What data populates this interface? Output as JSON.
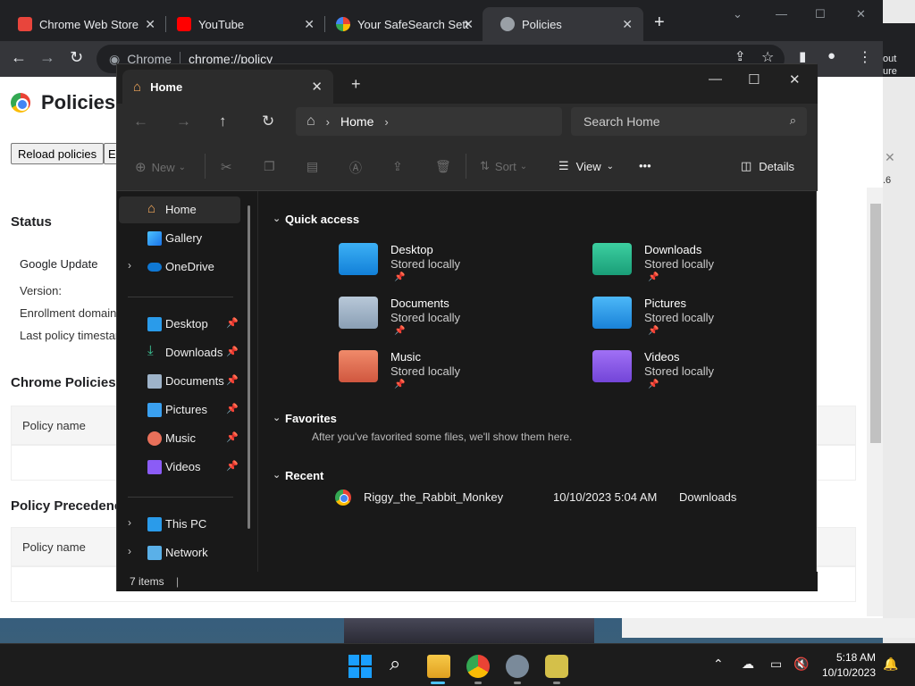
{
  "browser": {
    "tabs": [
      {
        "label": "Chrome Web Store"
      },
      {
        "label": "YouTube"
      },
      {
        "label": "Your SafeSearch Sett"
      },
      {
        "label": "Policies"
      }
    ],
    "new_tab": "+",
    "omnibox": {
      "site": "Chrome",
      "url": "chrome://policy"
    }
  },
  "policy_page": {
    "title": "Policies",
    "buttons": [
      "Reload policies",
      "E"
    ],
    "status_heading": "Status",
    "google_update": "Google Update",
    "version_label": "Version:",
    "enrollment_label": "Enrollment domain",
    "last_policy_label": "Last policy timestar",
    "chrome_policies_heading": "Chrome Policies",
    "policy_name_col": "Policy name",
    "precedence_heading": "Policy Precedenc",
    "precedence_col": "Policy name"
  },
  "behind_window": {
    "text_1": "out",
    "text_2": "ure",
    "text_3": ".6"
  },
  "explorer": {
    "tab_title": "Home",
    "breadcrumb": "Home",
    "search_placeholder": "Search Home",
    "commands": {
      "new": "New",
      "sort": "Sort",
      "view": "View",
      "more": "•••",
      "details": "Details"
    },
    "sidebar": {
      "top": [
        {
          "label": "Home"
        },
        {
          "label": "Gallery"
        },
        {
          "label": "OneDrive"
        }
      ],
      "pinned": [
        {
          "label": "Desktop"
        },
        {
          "label": "Downloads"
        },
        {
          "label": "Documents"
        },
        {
          "label": "Pictures"
        },
        {
          "label": "Music"
        },
        {
          "label": "Videos"
        }
      ],
      "bottom": [
        {
          "label": "This PC"
        },
        {
          "label": "Network"
        }
      ]
    },
    "quick_access_title": "Quick access",
    "quick_access": [
      {
        "name": "Desktop",
        "sub": "Stored locally"
      },
      {
        "name": "Downloads",
        "sub": "Stored locally"
      },
      {
        "name": "Documents",
        "sub": "Stored locally"
      },
      {
        "name": "Pictures",
        "sub": "Stored locally"
      },
      {
        "name": "Music",
        "sub": "Stored locally"
      },
      {
        "name": "Videos",
        "sub": "Stored locally"
      }
    ],
    "favorites_title": "Favorites",
    "favorites_empty": "After you've favorited some files, we'll show them here.",
    "recent_title": "Recent",
    "recent": [
      {
        "name": "Riggy_the_Rabbit_Monkey",
        "date": "10/10/2023 5:04 AM",
        "location": "Downloads"
      }
    ],
    "status": "7 items"
  },
  "taskbar": {
    "time": "5:18 AM",
    "date": "10/10/2023"
  },
  "colors": {
    "accent": "#4cc2ff",
    "explorer_bg": "#191919",
    "chrome_dark": "#202124"
  }
}
